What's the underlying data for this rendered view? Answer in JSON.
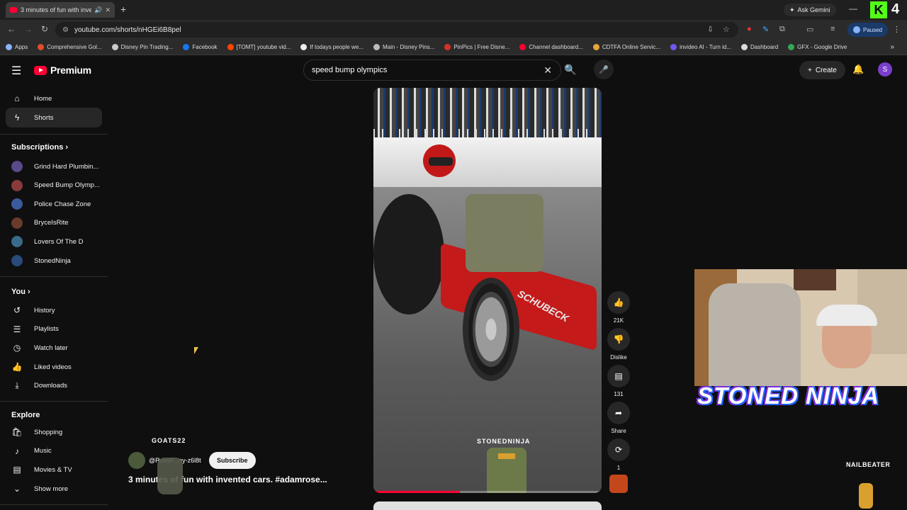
{
  "browser": {
    "tab_title": "3 minutes of fun with inven",
    "url": "youtube.com/shorts/nHGEi6B8pel",
    "gemini_label": "Ask Gemini",
    "paused_label": "Paused",
    "overlay_number": "4"
  },
  "bookmarks": [
    {
      "label": "Apps",
      "color": "#8ab4f8"
    },
    {
      "label": "Comprehensive Gol...",
      "color": "#e34a2e"
    },
    {
      "label": "Disney Pin Trading...",
      "color": "#cccccc"
    },
    {
      "label": "Facebook",
      "color": "#1877f2"
    },
    {
      "label": "[TOMT] youtube vid...",
      "color": "#ff4500"
    },
    {
      "label": "If todays people we...",
      "color": "#eeeeee"
    },
    {
      "label": "Main - Disney Pins...",
      "color": "#bbbbbb"
    },
    {
      "label": "PinPics | Free Disne...",
      "color": "#d93025"
    },
    {
      "label": "Channel dashboard...",
      "color": "#ff0033"
    },
    {
      "label": "CDTFA Online Servic...",
      "color": "#e8a33a"
    },
    {
      "label": "invideo AI - Turn id...",
      "color": "#6e5bf5"
    },
    {
      "label": "Dashboard",
      "color": "#dddddd"
    },
    {
      "label": "GFX - Google Drive",
      "color": "#34a853"
    }
  ],
  "youtube": {
    "brand": "Premium",
    "search_query": "speed bump olympics",
    "create_label": "Create",
    "avatar_letter": "S"
  },
  "sidebar": {
    "main": [
      {
        "label": "Home",
        "icon": "home-icon",
        "glyph": "⌂"
      },
      {
        "label": "Shorts",
        "icon": "shorts-icon",
        "glyph": "ϟ"
      }
    ],
    "subscriptions_title": "Subscriptions",
    "subscriptions": [
      {
        "label": "Grind Hard Plumbin...",
        "color": "#5a4a8a"
      },
      {
        "label": "Speed Bump Olymp...",
        "color": "#8a3a3a"
      },
      {
        "label": "Police Chase Zone",
        "color": "#3a5a9a"
      },
      {
        "label": "BryceIsRite",
        "color": "#6a3a2a"
      },
      {
        "label": "Lovers Of The D",
        "color": "#3a6a8a"
      },
      {
        "label": "StonedNinja",
        "color": "#2a4a7a"
      }
    ],
    "you_title": "You",
    "you": [
      {
        "label": "History",
        "glyph": "↺"
      },
      {
        "label": "Playlists",
        "glyph": "☰"
      },
      {
        "label": "Watch later",
        "glyph": "◷"
      },
      {
        "label": "Liked videos",
        "glyph": "👍"
      },
      {
        "label": "Downloads",
        "glyph": "⤓"
      }
    ],
    "explore_title": "Explore",
    "explore": [
      {
        "label": "Shopping",
        "glyph": "🛍"
      },
      {
        "label": "Music",
        "glyph": "♪"
      },
      {
        "label": "Movies & TV",
        "glyph": "▤"
      },
      {
        "label": "Show more",
        "glyph": "⌄"
      }
    ]
  },
  "short": {
    "overlay_name": "STONEDNINJA",
    "car_lettering": "SCHUBECK",
    "progress": 0.38,
    "channel_handle": "@RoesF...ny-z6l8t",
    "subscribe_label": "Subscribe",
    "title": "3 minutes of fun with invented cars. #adamrose...",
    "left_overlay_name": "GOATS22",
    "actions": {
      "likes": "21K",
      "dislike_label": "Dislike",
      "comments": "131",
      "share_label": "Share",
      "remix_count": "1"
    }
  },
  "stream_overlay": {
    "brand_text": "STONED NINJA",
    "right_name": "NAILBEATER"
  }
}
